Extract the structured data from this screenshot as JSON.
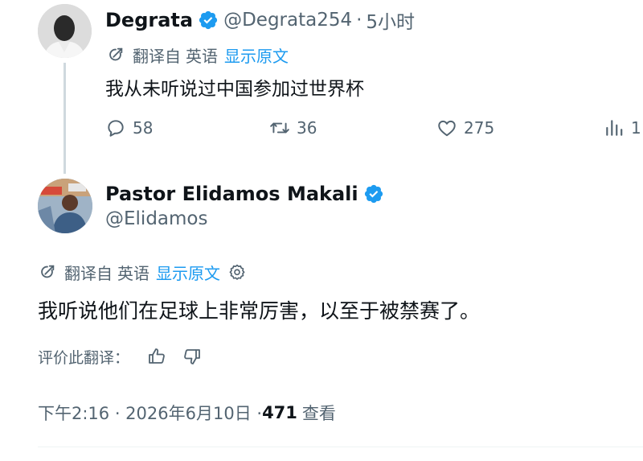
{
  "reply_parent": {
    "display_name": "Degrata",
    "handle": "@Degrata254",
    "separator": "·",
    "time_ago": "5小时",
    "translation": {
      "label": "翻译自",
      "language": "英语",
      "show_original": "显示原文"
    },
    "text": "我从未听说过中国参加过世界杯",
    "actions": {
      "replies": "58",
      "retweets": "36",
      "likes": "275",
      "views": "1"
    }
  },
  "main_tweet": {
    "display_name": "Pastor Elidamos Makali",
    "handle": "@Elidamos",
    "translation": {
      "label": "翻译自",
      "language": "英语",
      "show_original": "显示原文"
    },
    "text": "我听说他们在足球上非常厉害，以至于被禁赛了。",
    "rate_translation_label": "评价此翻译：",
    "timestamp": "下午2:16 · 2026年6月10日 · ",
    "views_count": "471",
    "views_label": "查看"
  },
  "colors": {
    "accent": "#1d9bf0",
    "secondary_text": "#536471",
    "primary_text": "#0f1419",
    "thread_line": "#cfd9de"
  },
  "icons": {
    "verified": "verified-badge-icon",
    "translate": "translate-icon",
    "reply": "reply-icon",
    "retweet": "retweet-icon",
    "like": "heart-icon",
    "views": "views-bar-chart-icon",
    "settings": "gear-icon",
    "thumbs_up": "thumbs-up-icon",
    "thumbs_down": "thumbs-down-icon"
  }
}
